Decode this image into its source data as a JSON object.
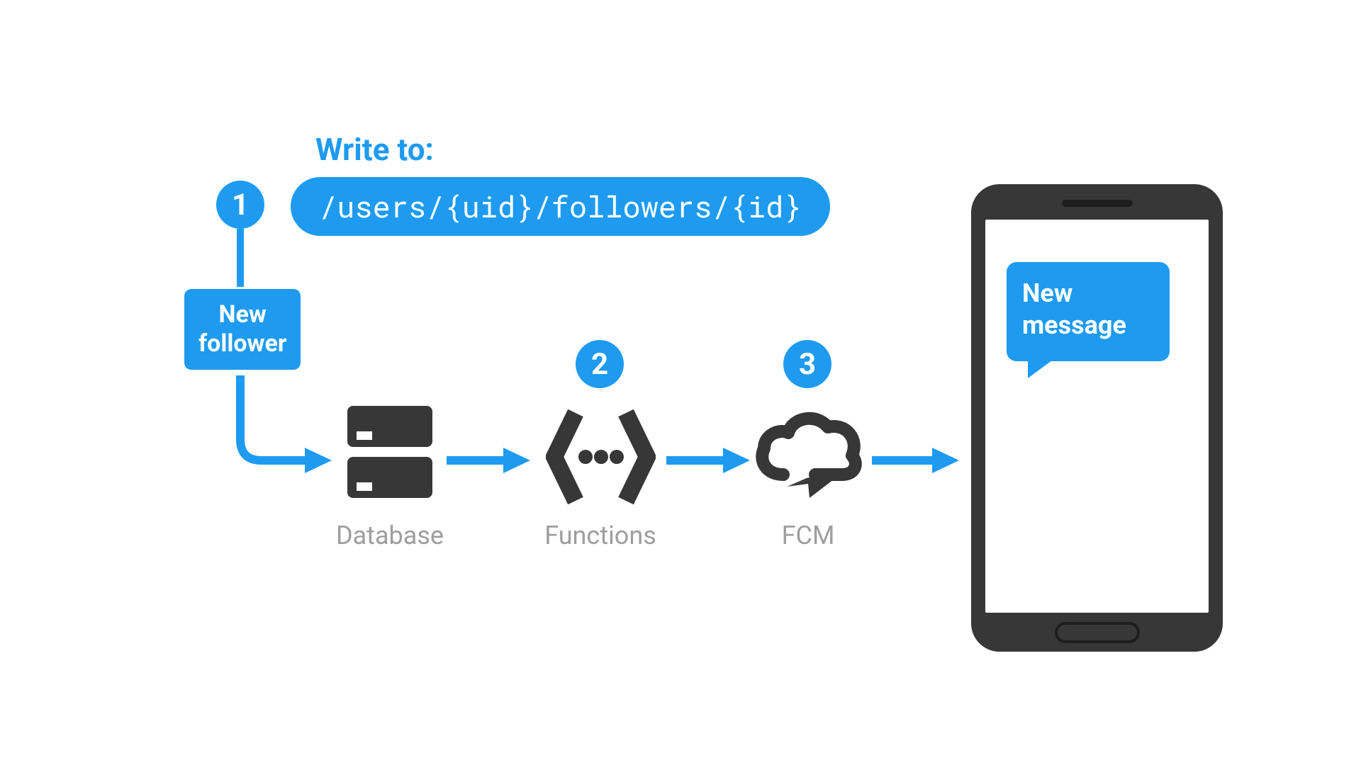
{
  "header": {
    "write_to_label": "Write to:",
    "path": "/users/{uid}/followers/{id}"
  },
  "badges": {
    "one": "1",
    "two": "2",
    "three": "3"
  },
  "trigger": {
    "label_line1": "New",
    "label_line2": "follower"
  },
  "services": {
    "database": "Database",
    "functions": "Functions",
    "fcm": "FCM"
  },
  "phone": {
    "notification_line1": "New",
    "notification_line2": "message"
  },
  "colors": {
    "accent": "#1E9BF0",
    "icon": "#373737",
    "label": "#9E9E9E"
  }
}
